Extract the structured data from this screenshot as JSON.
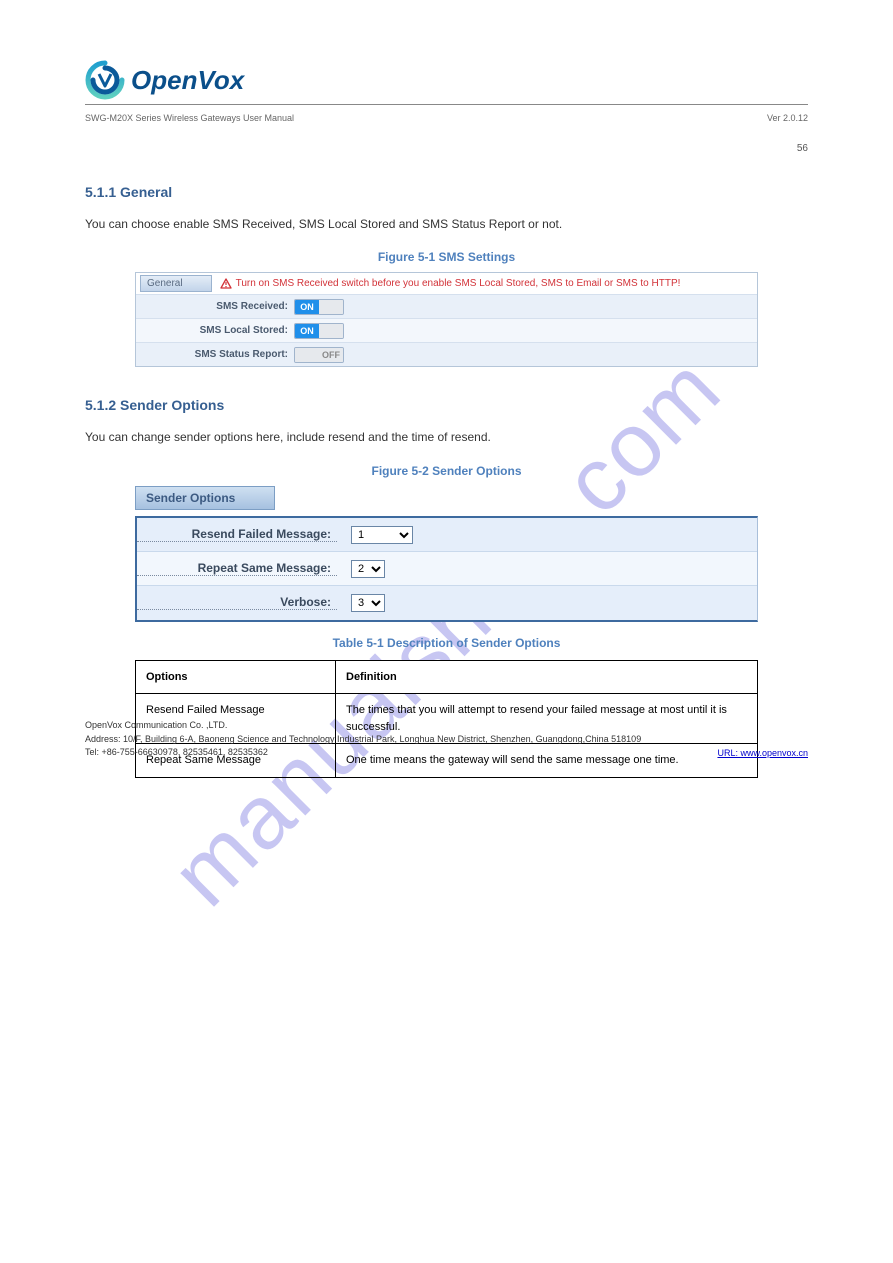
{
  "brand": "OpenVox",
  "doc_meta_left": "SWG-M20X Series Wireless Gateways User Manual",
  "doc_meta_right": "Ver 2.0.12",
  "page_number": "56",
  "watermark": "manualshive.com",
  "sect1": {
    "heading": "5.1.1 General",
    "para": "You can choose enable SMS Received, SMS Local Stored and SMS Status Report or not.",
    "fig_caption": "Figure 5-1 SMS Settings",
    "tab": "General",
    "warning": "Turn on SMS Received switch before you enable SMS Local Stored, SMS to Email or SMS to HTTP!",
    "rows": [
      {
        "label": "SMS Received:",
        "state": "on"
      },
      {
        "label": "SMS Local Stored:",
        "state": "on"
      },
      {
        "label": "SMS Status Report:",
        "state": "off"
      }
    ],
    "on_text": "ON",
    "off_text": "OFF"
  },
  "sect2": {
    "heading": "5.1.2 Sender Options",
    "para": "You can change sender options here, include resend and the time of resend.",
    "fig_caption": "Figure 5-2 Sender Options",
    "header": "Sender Options",
    "rows": [
      {
        "label": "Resend Failed Message:",
        "value": "1",
        "wide": true
      },
      {
        "label": "Repeat Same Message:",
        "value": "2",
        "wide": false
      },
      {
        "label": "Verbose:",
        "value": "3",
        "wide": false
      }
    ]
  },
  "def_table": {
    "caption": "Table 5-1 Description of Sender Options",
    "head": {
      "opt": "Options",
      "def": "Definition"
    },
    "rows": [
      {
        "opt": "Resend Failed Message",
        "def": "The times that you will attempt to resend your failed message at most until it is successful."
      },
      {
        "opt": "Repeat Same Message",
        "def": "One time means the gateway will send the same message one time."
      }
    ]
  },
  "footer": {
    "company": "OpenVox Communication Co. ,LTD.",
    "address": "Address: 10/F, Building 6-A, Baoneng Science and Technology Industrial Park, Longhua New District, Shenzhen,  Guangdong,China  518109",
    "tel": "Tel: +86-755-66630978, 82535461, 82535362",
    "url": "URL: www.openvox.cn"
  }
}
